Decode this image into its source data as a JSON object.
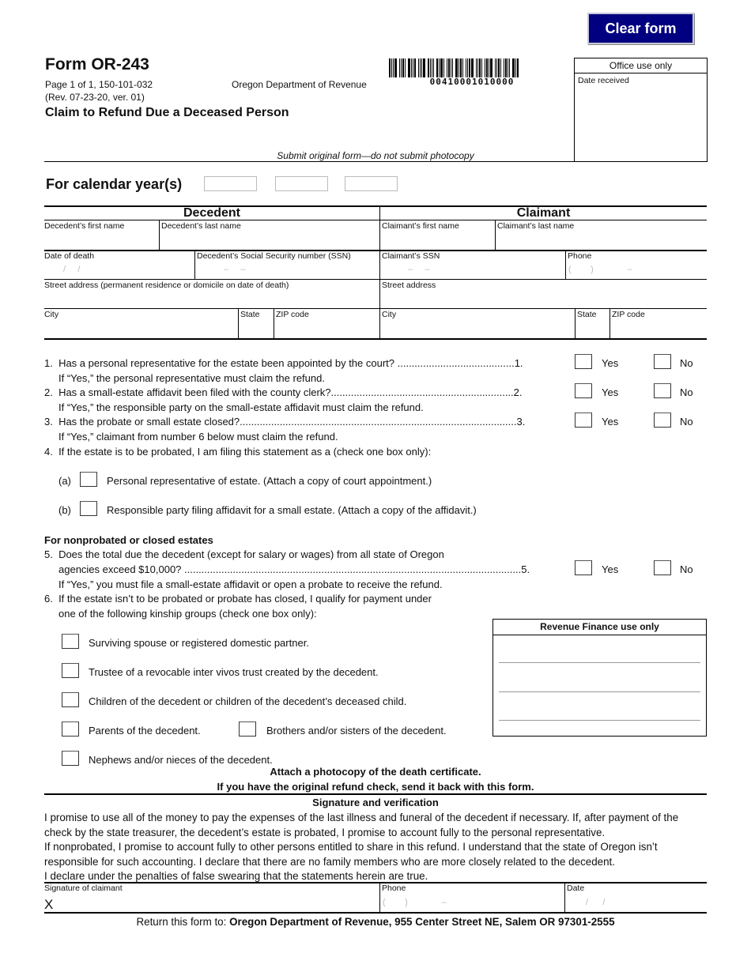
{
  "toolbar": {
    "clear_form_label": "Clear form"
  },
  "header": {
    "form_number": "Form OR-243",
    "page_info": "Page 1 of 1, 150-101-032",
    "revision": "(Rev. 07-23-20, ver. 01)",
    "agency": "Oregon Department of Revenue",
    "title": "Claim to Refund Due a Deceased Person",
    "barcode_number": "00410001010000",
    "submit_note": "Submit original form—do not submit photocopy"
  },
  "office_use": {
    "heading": "Office use only",
    "date_received_label": "Date received"
  },
  "calendar_years": {
    "label": "For calendar year(s)",
    "values": [
      "",
      "",
      ""
    ]
  },
  "decedent": {
    "heading": "Decedent",
    "first_name_label": "Decedent’s first name",
    "last_name_label": "Decedent’s last name",
    "date_of_death_label": "Date of death",
    "date_mask": "/     /",
    "ssn_label": "Decedent’s Social Security number (SSN)",
    "ssn_mask": "–     –",
    "street_label": "Street address (permanent residence or domicile on date of death)",
    "city_label": "City",
    "state_label": "State",
    "zip_label": "ZIP code"
  },
  "claimant": {
    "heading": "Claimant",
    "first_name_label": "Claimant’s first name",
    "last_name_label": "Claimant’s last name",
    "ssn_label": "Claimant’s SSN",
    "ssn_mask": "–     –",
    "phone_label": "Phone",
    "phone_mask": "(        )              –",
    "street_label": "Street address",
    "city_label": "City",
    "state_label": "State",
    "zip_label": "ZIP code"
  },
  "questions": {
    "yes_label": "Yes",
    "no_label": "No",
    "q1": {
      "text": "1.  Has a personal representative for the estate been appointed by the court? .........................................1.",
      "note": "If “Yes,” the personal representative must claim the refund."
    },
    "q2": {
      "text": "2.  Has a small-estate affidavit been filed with the county clerk?................................................................2.",
      "note": "If “Yes,” the responsible party on the small-estate affidavit must claim the refund."
    },
    "q3": {
      "text": "3.  Has the probate or small estate closed?.................................................................................................3.",
      "note": "If “Yes,” claimant from number 6 below must claim the refund."
    },
    "q4": {
      "text": "4.  If the estate is to be probated, I am filing this statement as a (check one box only):",
      "option_a_letter": "(a)",
      "option_a": "Personal representative of estate. (Attach a copy of court appointment.)",
      "option_b_letter": "(b)",
      "option_b": "Responsible party filing affidavit for a small estate. (Attach a copy of the affidavit.)"
    },
    "nonprobated_heading": "For nonprobated or closed estates",
    "q5": {
      "line1": "5.  Does the total due the decedent (except for salary or wages) from all state of Oregon",
      "line2": "agencies exceed $10,000? ......................................................................................................................5.",
      "note": "If “Yes,” you must file a small-estate affidavit or open a probate to receive the refund."
    },
    "q6": {
      "line1": "6.  If the estate isn’t to be probated or probate has closed, I qualify for payment under",
      "line2": "one of the following kinship groups (check one box only):",
      "options": [
        "Surviving spouse or registered domestic partner.",
        "Trustee of a revocable inter vivos trust created by the decedent.",
        "Children of the decedent or children of the decedent’s deceased child.",
        "Parents of the decedent.",
        "Brothers and/or sisters of the decedent.",
        "Nephews and/or nieces of the decedent."
      ]
    }
  },
  "revenue_finance": {
    "heading": "Revenue Finance use only"
  },
  "instructions": {
    "attach": "Attach a photocopy of the death certificate.",
    "return_check": "If you have the original refund check, send it back with this form."
  },
  "signature": {
    "heading": "Signature and verification",
    "para1": "I promise to use all of the money to pay the expenses of the last illness and funeral of the decedent if necessary. If, after payment of the check by the state treasurer, the decedent’s estate is probated, I promise to account fully to the personal representative.",
    "para2": "If nonprobated, I promise to account fully to other persons entitled to share in this refund. I understand that the state of Oregon isn’t responsible for such accounting. I declare that there are no family members who are more closely related to the decedent.",
    "para3": "I declare under the penalties of false swearing that the statements herein are true.",
    "signature_label": "Signature of claimant",
    "signature_mark": "X",
    "phone_label": "Phone",
    "phone_mask": "(        )              –",
    "date_label": "Date",
    "date_mask": "/      /"
  },
  "footer": {
    "return_prefix": "Return this form to: ",
    "return_address": "Oregon Department of Revenue, 955 Center Street NE, Salem OR 97301-2555"
  }
}
